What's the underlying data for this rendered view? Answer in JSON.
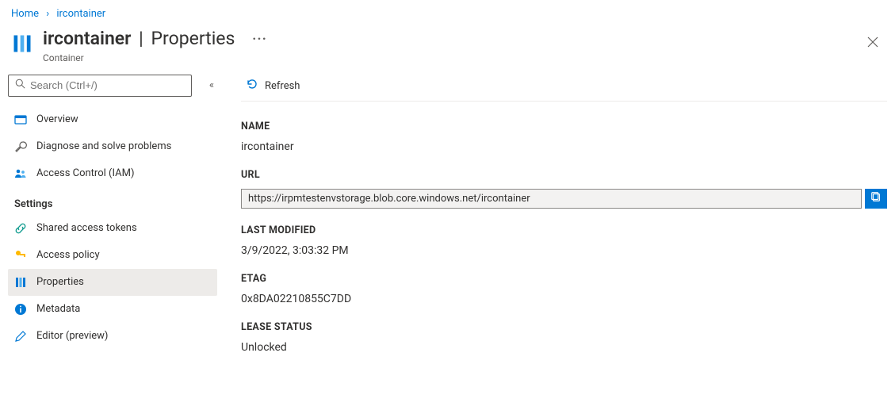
{
  "breadcrumb": {
    "home": "Home",
    "item": "ircontainer"
  },
  "header": {
    "resource": "ircontainer",
    "section": "Properties",
    "subtitle": "Container",
    "ellipsis": "···"
  },
  "search": {
    "placeholder": "Search (Ctrl+/)"
  },
  "sidebar": {
    "overview": "Overview",
    "diagnose": "Diagnose and solve problems",
    "iam": "Access Control (IAM)",
    "group_settings": "Settings",
    "sas": "Shared access tokens",
    "policy": "Access policy",
    "properties": "Properties",
    "metadata": "Metadata",
    "editor": "Editor (preview)"
  },
  "toolbar": {
    "refresh": "Refresh"
  },
  "props": {
    "name_label": "NAME",
    "name_value": "ircontainer",
    "url_label": "URL",
    "url_value": "https://irpmtestenvstorage.blob.core.windows.net/ircontainer",
    "modified_label": "LAST MODIFIED",
    "modified_value": "3/9/2022, 3:03:32 PM",
    "etag_label": "ETAG",
    "etag_value": "0x8DA02210855C7DD",
    "lease_label": "LEASE STATUS",
    "lease_value": "Unlocked"
  }
}
